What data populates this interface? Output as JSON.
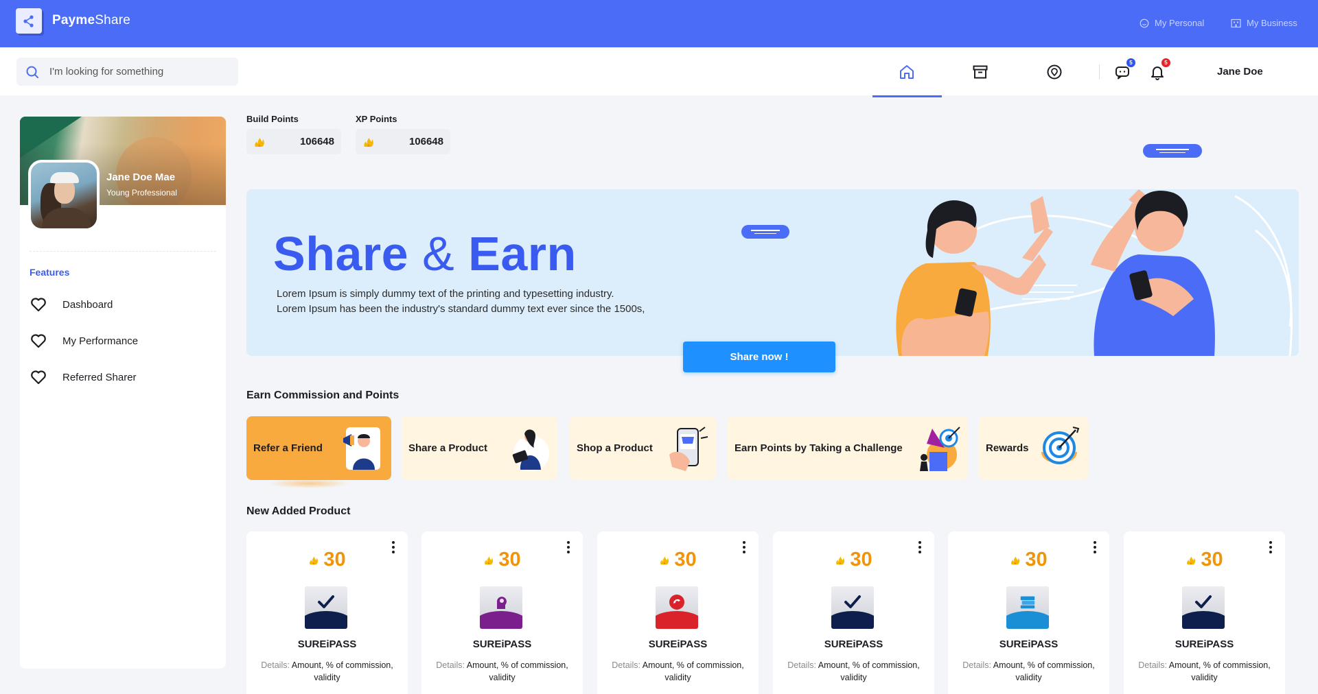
{
  "app": {
    "name_bold": "Payme",
    "name_rest": "Share"
  },
  "top_links": {
    "personal": "My Personal",
    "business": "My Business"
  },
  "search": {
    "placeholder": "I'm looking for something"
  },
  "nav": {
    "active_tab": "home",
    "messages_badge": "5",
    "notifications_badge": "5",
    "username": "Jane Doe"
  },
  "profile": {
    "name": "Jane Doe Mae",
    "title": "Young Professional"
  },
  "sidebar": {
    "section_label": "Features",
    "items": [
      {
        "label": "Dashboard"
      },
      {
        "label": "My Performance"
      },
      {
        "label": "Referred Sharer"
      }
    ]
  },
  "points": {
    "build_label": "Build Points",
    "build_value": "106648",
    "xp_label": "XP Points",
    "xp_value": "106648"
  },
  "banner": {
    "title_a": "Share",
    "title_amp": "&",
    "title_b": "Earn",
    "line1": "Lorem Ipsum is simply dummy text of the printing and typesetting industry.",
    "line2": "Lorem Ipsum has been the industry's standard dummy text ever since the 1500s,",
    "button": "Share now !"
  },
  "earn": {
    "title": "Earn Commission and Points",
    "cards": [
      {
        "label": "Refer a Friend",
        "active": true
      },
      {
        "label": "Share a Product"
      },
      {
        "label": "Shop a Product"
      },
      {
        "label": "Earn Points by Taking a Challenge"
      },
      {
        "label": "Rewards"
      }
    ]
  },
  "products": {
    "title": "New Added Product",
    "items": [
      {
        "points": "30",
        "name": "SUREiPASS",
        "details_key": "Details:",
        "details_value": "Amount, % of commission, validity",
        "accent": "#0f1f4d"
      },
      {
        "points": "30",
        "name": "SUREiPASS",
        "details_key": "Details:",
        "details_value": "Amount, % of commission, validity",
        "accent": "#7a1f8c"
      },
      {
        "points": "30",
        "name": "SUREiPASS",
        "details_key": "Details:",
        "details_value": "Amount, % of commission, validity",
        "accent": "#d9222a"
      },
      {
        "points": "30",
        "name": "SUREiPASS",
        "details_key": "Details:",
        "details_value": "Amount, % of commission, validity",
        "accent": "#0f1f4d"
      },
      {
        "points": "30",
        "name": "SUREiPASS",
        "details_key": "Details:",
        "details_value": "Amount, % of commission, validity",
        "accent": "#1b8fd6"
      },
      {
        "points": "30",
        "name": "SUREiPASS",
        "details_key": "Details:",
        "details_value": "Amount, % of commission, validity",
        "accent": "#0f1f4d"
      }
    ]
  },
  "colors": {
    "primary": "#4a6cf7",
    "accent_orange": "#f9aa3e",
    "points_orange": "#f0940a",
    "button_blue": "#1e90ff"
  }
}
